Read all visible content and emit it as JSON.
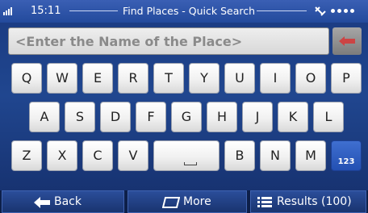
{
  "status": {
    "time": "15:11",
    "title": "Find Places - Quick Search"
  },
  "search": {
    "placeholder": "<Enter the Name of the Place>"
  },
  "keyboard": {
    "row1": [
      "Q",
      "W",
      "E",
      "R",
      "T",
      "Y",
      "U",
      "I",
      "O",
      "P"
    ],
    "row2": [
      "A",
      "S",
      "D",
      "F",
      "G",
      "H",
      "J",
      "K",
      "L"
    ],
    "row3": [
      "Z",
      "X",
      "C",
      "V",
      "B",
      "N",
      "M"
    ],
    "mode_label": "123"
  },
  "footer": {
    "back": "Back",
    "more": "More",
    "results": "Results (100)"
  },
  "colors": {
    "background": "#1a3a80",
    "mode_key": "#2f5fc4"
  }
}
